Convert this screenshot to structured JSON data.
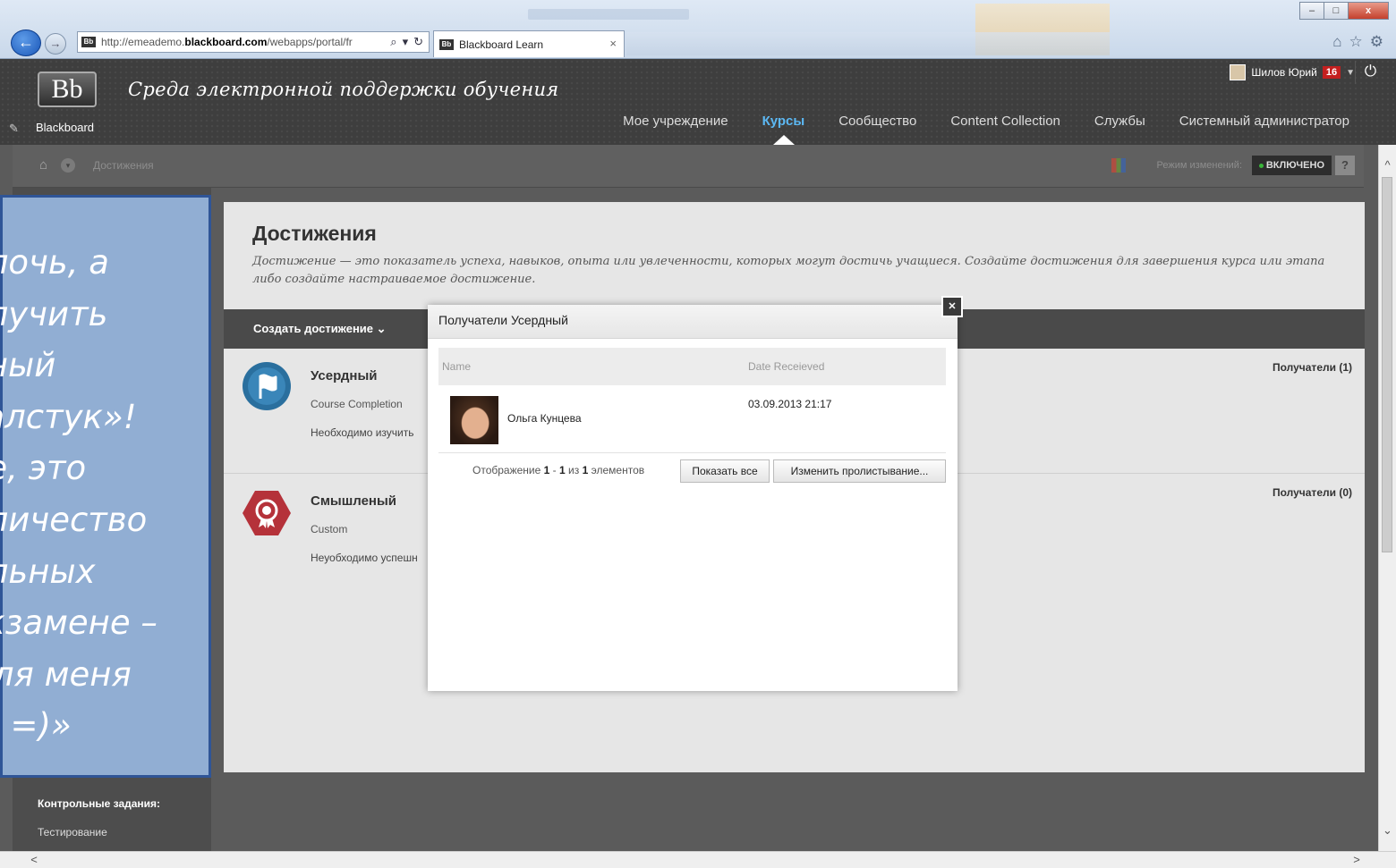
{
  "browser": {
    "url_prefix": "http://emeademo.",
    "url_domain": "blackboard.com",
    "url_path": "/webapps/portal/fr",
    "search_icon": "⌕",
    "dropdown_icon": "▾",
    "refresh_icon": "↻",
    "tab_title": "Blackboard Learn",
    "tab_close": "×",
    "favicon": "Bb",
    "back_icon": "←",
    "forward_icon": "→",
    "home_icon": "⌂",
    "favorites_icon": "☆",
    "settings_icon": "⚙",
    "minimize": "–",
    "maximize": "□",
    "close": "x"
  },
  "header": {
    "logo": "Bb",
    "logo_text": "Blackboard",
    "site_title": "Среда электронной поддержки обучения",
    "user_name": "Шилов Юрий",
    "notification_count": "16",
    "caret": "▼",
    "power_icon": "⏻",
    "pen_icon": "✎",
    "nav": [
      "Мое учреждение",
      "Курсы",
      "Сообщество",
      "Content Collection",
      "Службы",
      "Системный администратор"
    ],
    "active_nav": "Курсы"
  },
  "breadcrumb": {
    "home_icon": "⌂",
    "current": "Достижения",
    "edit_mode_label": "Режим изменений:",
    "edit_mode_value": "ВКЛЮЧЕНО",
    "help": "?"
  },
  "left_menu": {
    "section_title": "Контрольные задания:",
    "item": "Тестирование"
  },
  "main": {
    "title": "Достижения",
    "description": "Достижение — это показатель успеха, навыков, опыта или увлеченности, которых могут достичь учащиеся. Создайте достижения для завершения курса или этапа либо создайте настраиваемое достижение.",
    "create_button": "Создать достижение",
    "create_caret": "⌄",
    "achievements": [
      {
        "name": "Усердный",
        "type": "Course Completion",
        "desc": "Необходимо изучить",
        "recipients": "Получатели (1)",
        "color": "#2a6f9e"
      },
      {
        "name": "Смышленый",
        "type": "Custom",
        "desc": "Неуобходимо успешн",
        "recipients": "Получатели (0)",
        "color": "#b5323a"
      }
    ]
  },
  "modal": {
    "title": "Получатели Усердный",
    "close_icon": "✕",
    "col_name": "Name",
    "col_date": "Date Receieved",
    "rows": [
      {
        "name": "Ольга Кунцева",
        "date": "03.09.2013 21:17"
      }
    ],
    "pager_prefix": "Отображение",
    "pager_from": "1",
    "pager_dash": "-",
    "pager_to": "1",
    "pager_of": "из",
    "pager_total": "1",
    "pager_suffix": "элементов",
    "show_all": "Показать все",
    "edit_paging": "Изменить пролистывание..."
  },
  "overlay": {
    "lines": [
      "елочь, а",
      "олучить",
      "ьный",
      "галстук»!",
      "ке, это",
      "оличество",
      "ельных",
      "экзамене –",
      "Для меня",
      "у! =)»"
    ]
  },
  "scroll": {
    "up": "^",
    "down": "⌄",
    "left": "<",
    "right": ">"
  }
}
